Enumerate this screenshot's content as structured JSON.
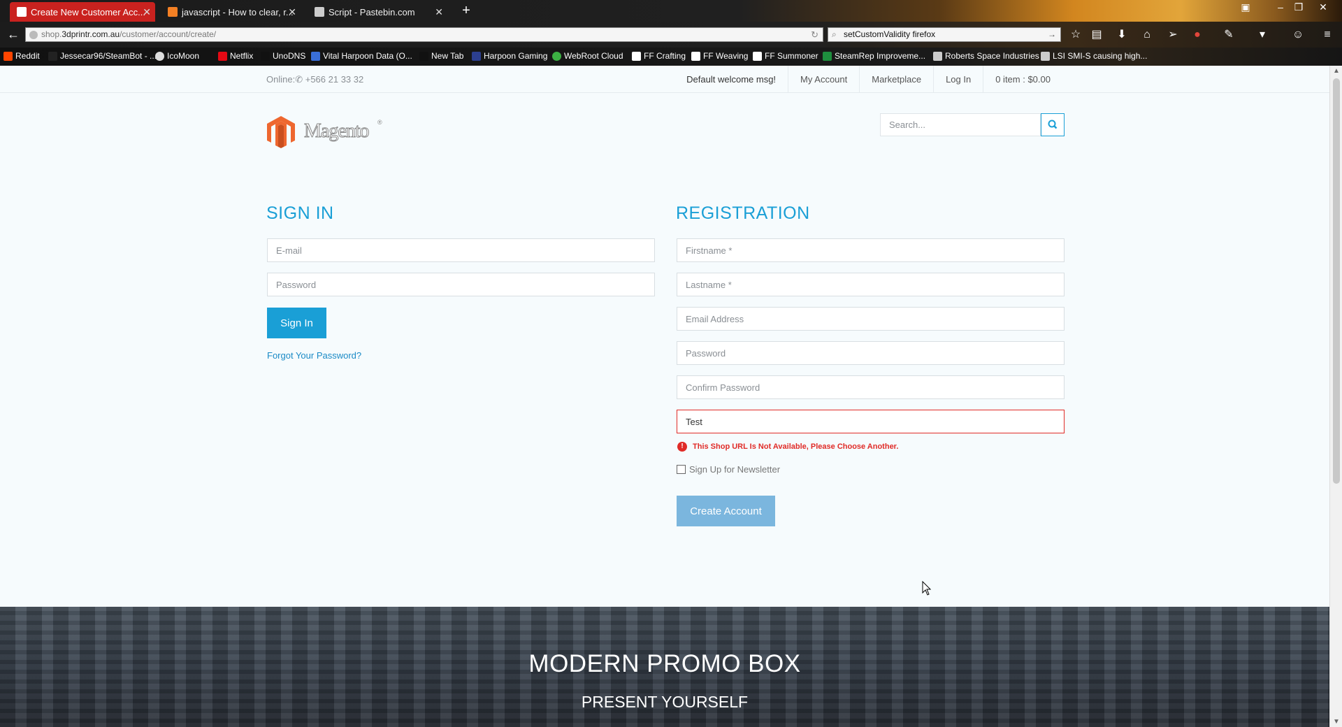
{
  "browser": {
    "tabs": [
      {
        "label": "Create New Customer Acc...",
        "active": true
      },
      {
        "label": "javascript - How to clear, r...",
        "active": false
      },
      {
        "label": "Script - Pastebin.com",
        "active": false
      }
    ],
    "url": {
      "prefix": "shop.",
      "host": "3dprintr.com.au",
      "path": "/customer/account/create/"
    },
    "search": "setCustomValidity firefox",
    "bookmarks": [
      "Reddit",
      "Jessecar96/SteamBot - ...",
      "IcoMoon",
      "Netflix",
      "UnoDNS",
      "Vital Harpoon Data (O...",
      "New Tab",
      "Harpoon Gaming",
      "WebRoot Cloud",
      "FF Crafting",
      "FF Weaving",
      "FF Summoner",
      "SteamRep Improveme...",
      "Roberts Space Industries",
      "LSI SMI-S causing high..."
    ]
  },
  "header": {
    "online_label": "Online:",
    "phone": "+566 21 33 32",
    "nav": [
      "Default welcome msg!",
      "My Account",
      "Marketplace",
      "Log In",
      "0 item : $0.00"
    ],
    "logo_text": "Magento",
    "search_placeholder": "Search..."
  },
  "signin": {
    "title": "SIGN IN",
    "email_placeholder": "E-mail",
    "password_placeholder": "Password",
    "button": "Sign In",
    "forgot": "Forgot Your Password?"
  },
  "registration": {
    "title": "REGISTRATION",
    "firstname_placeholder": "Firstname *",
    "lastname_placeholder": "Lastname *",
    "email_placeholder": "Email Address",
    "password_placeholder": "Password",
    "confirm_placeholder": "Confirm Password",
    "shop_url_value": "Test",
    "error": "This Shop URL Is Not Available, Please Choose Another.",
    "newsletter": "Sign Up for Newsletter",
    "button": "Create Account"
  },
  "promo": {
    "title": "MODERN PROMO BOX",
    "subtitle": "PRESENT YOURSELF"
  },
  "colors": {
    "accent": "#1a9fd6",
    "error": "#e02b27",
    "disabled_button": "#7bb6de"
  }
}
